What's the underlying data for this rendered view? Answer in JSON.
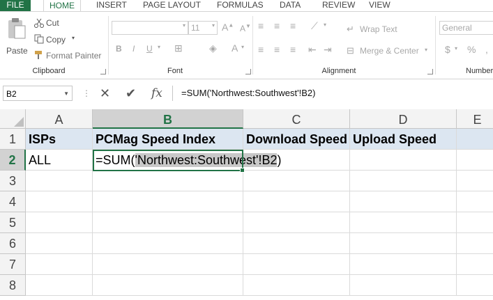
{
  "tabs": [
    "FILE",
    "HOME",
    "INSERT",
    "PAGE LAYOUT",
    "FORMULAS",
    "DATA",
    "REVIEW",
    "VIEW"
  ],
  "clipboard": {
    "paste": "Paste",
    "cut": "Cut",
    "copy": "Copy",
    "format_painter": "Format Painter",
    "group": "Clipboard"
  },
  "font": {
    "size": "11",
    "group": "Font"
  },
  "alignment": {
    "wrap_text": "Wrap Text",
    "merge_center": "Merge & Center",
    "group": "Alignment"
  },
  "number": {
    "format": "General",
    "group": "Number"
  },
  "formula_bar": {
    "name_box": "B2",
    "formula": "=SUM('Northwest:Southwest'!B2)",
    "fx": "fx"
  },
  "columns": [
    "A",
    "B",
    "C",
    "D",
    "E"
  ],
  "rows": [
    "1",
    "2",
    "3",
    "4",
    "5",
    "6",
    "7",
    "8"
  ],
  "cells": {
    "A1": "ISPs",
    "B1": "PCMag Speed Index",
    "C1": "Download Speed",
    "D1": "Upload Speed",
    "A2": "ALL",
    "B2_prefix": "=SUM(",
    "B2_ref": "'Northwest:Southwest'!B2",
    "B2_suffix": ")"
  },
  "colors": {
    "accent": "#217346",
    "header_fill": "#dce6f1",
    "selection": "#d2d2d2"
  }
}
